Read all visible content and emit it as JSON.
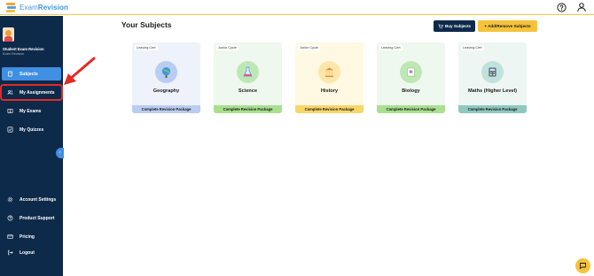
{
  "app": {
    "logo_text_a": "Exam",
    "logo_text_b": "Revision"
  },
  "header": {
    "help_icon": "question-circle-icon",
    "user_icon": "user-icon"
  },
  "profile": {
    "name": "Student Exam Revision",
    "subtitle": "Exam Revision"
  },
  "sidebar": {
    "items": [
      {
        "label": "Subjects",
        "icon": "book-icon"
      },
      {
        "label": "My Assignments",
        "icon": "users-icon"
      },
      {
        "label": "My Exams",
        "icon": "open-book-icon"
      },
      {
        "label": "My Quizzes",
        "icon": "checkbox-icon"
      },
      {
        "label": "Account Settings",
        "icon": "gear-icon"
      },
      {
        "label": "Product Support",
        "icon": "help-icon"
      },
      {
        "label": "Pricing",
        "icon": "card-icon"
      },
      {
        "label": "Logout",
        "icon": "logout-icon"
      }
    ],
    "collapse_glyph": "‹"
  },
  "main": {
    "title": "Your Subjects",
    "buy_label": "Buy Subjects",
    "add_label": "+ Add/Remove Subjects"
  },
  "subjects": [
    {
      "tag": "Leaving Cert",
      "name": "Geography",
      "package": "Complete Revision Package",
      "bg": "#eef2fb",
      "circle": "#b9cdf0",
      "bar": "#b9cdf0"
    },
    {
      "tag": "Junior Cycle",
      "name": "Science",
      "package": "Complete Revision Package",
      "bg": "#eef8ee",
      "circle": "#bfe7b6",
      "bar": "#a8e08f"
    },
    {
      "tag": "Junior Cycle",
      "name": "History",
      "package": "Complete Revision Package",
      "bg": "#fff8e3",
      "circle": "#fbe7a8",
      "bar": "#f8d76a"
    },
    {
      "tag": "Leaving Cert",
      "name": "Biology",
      "package": "Complete Revision Package",
      "bg": "#eef8ee",
      "circle": "#bfe7b6",
      "bar": "#a8e08f"
    },
    {
      "tag": "Leaving Cert",
      "name": "Maths (Higher Level)",
      "package": "Complete Revision Package",
      "bg": "#eef6f4",
      "circle": "#bfe2dc",
      "bar": "#8ec9c0"
    }
  ],
  "colors": {
    "sidebar_bg": "#0e2a4a",
    "active_item": "#3f8fe3",
    "accent_yellow": "#f5c33b",
    "highlight_red": "#e12b24"
  }
}
